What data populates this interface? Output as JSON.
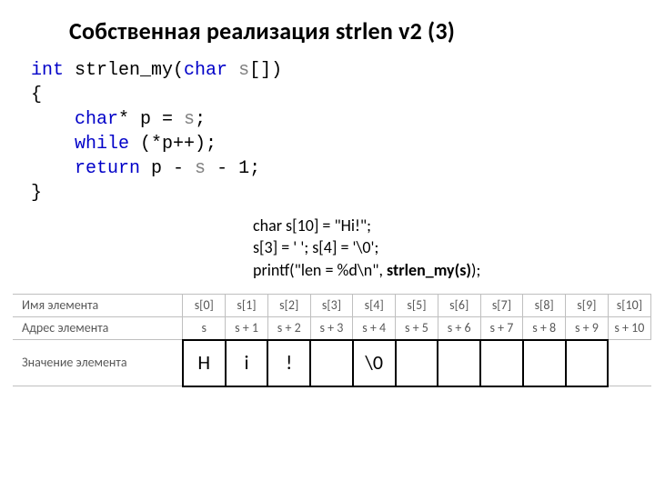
{
  "title": "Собственная реализация strlen v2 (3)",
  "code": {
    "l1a": "int",
    "l1b": " strlen_my(",
    "l1c": "char",
    "l1d": " s",
    "l1e": "[])",
    "l2": "{",
    "l3a": "    ",
    "l3b": "char",
    "l3c": "* p = ",
    "l3d": "s",
    "l3e": ";",
    "l4a": "    ",
    "l4b": "while",
    "l4c": " (*p++);",
    "l5a": "    ",
    "l5b": "return",
    "l5c": " p - ",
    "l5d": "s",
    "l5e": " - 1;",
    "l6": "}"
  },
  "snippet": {
    "l1": "char s[10] = \"Hi!\";",
    "l2": "s[3] = ' '; s[4] = '\\0';",
    "l3a": "printf(\"len = %d\\n\", ",
    "l3b": "strlen_my(s)",
    "l3c": ");"
  },
  "table": {
    "row_labels": [
      "Имя элемента",
      "Адрес элемента",
      "Значение элемента"
    ],
    "names": [
      "s[0]",
      "s[1]",
      "s[2]",
      "s[3]",
      "s[4]",
      "s[5]",
      "s[6]",
      "s[7]",
      "s[8]",
      "s[9]",
      "s[10]"
    ],
    "addrs": [
      "s",
      "s + 1",
      "s + 2",
      "s + 3",
      "s + 4",
      "s + 5",
      "s + 6",
      "s + 7",
      "s + 8",
      "s + 9",
      "s + 10"
    ],
    "values": [
      "H",
      "i",
      "!",
      "",
      "\\0",
      "",
      "",
      "",
      "",
      "",
      ""
    ]
  }
}
